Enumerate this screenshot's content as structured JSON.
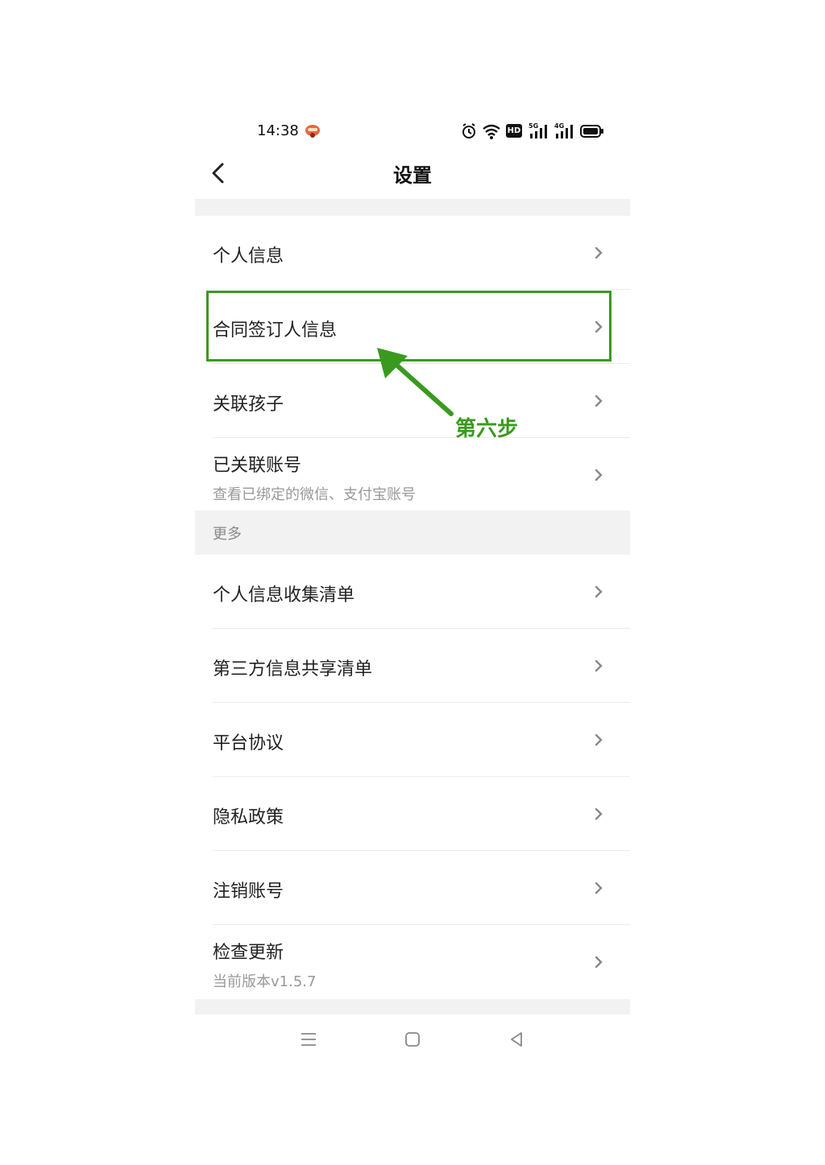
{
  "status_bar": {
    "time": "14:38",
    "app_badge_icon": "app-notification-icon",
    "icons": [
      "alarm-icon",
      "wifi-icon",
      "hd-icon",
      "5g-signal-icon",
      "4g-signal-icon",
      "battery-icon"
    ],
    "hd_text": "HD",
    "signal_5g": "5G",
    "signal_4g": "4G"
  },
  "nav": {
    "title": "设置",
    "back_icon": "chevron-left-icon"
  },
  "group1": [
    {
      "label": "个人信息"
    },
    {
      "label": "合同签订人信息"
    },
    {
      "label": "关联孩子"
    },
    {
      "label": "已关联账号",
      "sub": "查看已绑定的微信、支付宝账号"
    }
  ],
  "section_more": {
    "title": "更多"
  },
  "group2": [
    {
      "label": "个人信息收集清单"
    },
    {
      "label": "第三方信息共享清单"
    },
    {
      "label": "平台协议"
    },
    {
      "label": "隐私政策"
    },
    {
      "label": "注销账号"
    },
    {
      "label": "检查更新",
      "sub": "当前版本v1.5.7"
    }
  ],
  "annotation": {
    "step_label": "第六步",
    "color": "#3a9a1f"
  },
  "system_nav": [
    "menu-icon",
    "home-icon",
    "back-triangle-icon"
  ]
}
